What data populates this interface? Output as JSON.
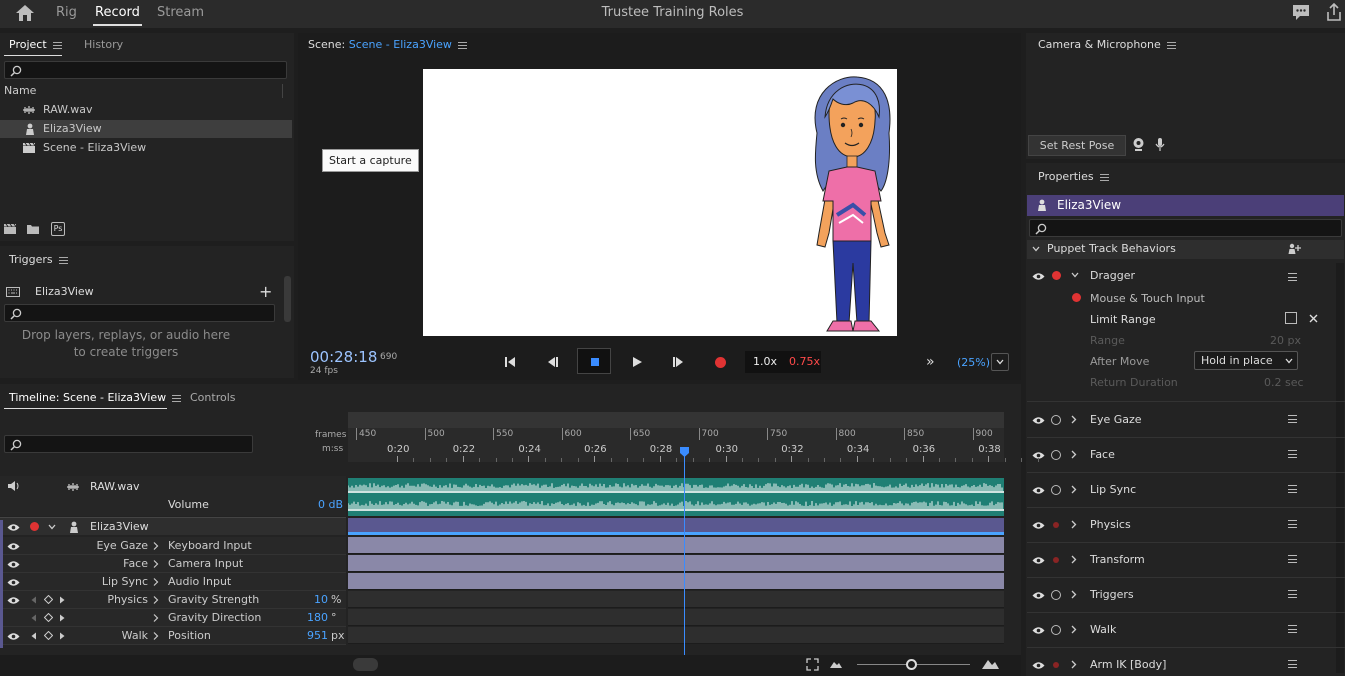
{
  "topbar": {
    "tabs": [
      "Rig",
      "Record",
      "Stream"
    ],
    "active_tab": "Record",
    "title": "Trustee Training Roles"
  },
  "project": {
    "tabs": [
      "Project",
      "History"
    ],
    "name_header": "Name",
    "items": [
      {
        "label": "RAW.wav",
        "icon": "audio-waveform-icon"
      },
      {
        "label": "Eliza3View",
        "icon": "puppet-icon",
        "selected": true
      },
      {
        "label": "Scene - Eliza3View",
        "icon": "scene-clapper-icon"
      }
    ],
    "ps_badge": "Ps"
  },
  "triggers": {
    "title": "Triggers",
    "puppet": "Eliza3View",
    "empty_text_1": "Drop layers, replays, or audio here",
    "empty_text_2": "to create triggers"
  },
  "scene": {
    "label": "Scene:",
    "name": "Scene - Eliza3View",
    "tooltip": "Start a capture",
    "timecode": "00:28:18",
    "frame": "690",
    "fps": "24 fps",
    "speed_a": "1.0x",
    "speed_b": "0.75x",
    "zoom": "(25%)"
  },
  "camera": {
    "title": "Camera & Microphone",
    "rest_pose": "Set Rest Pose"
  },
  "properties": {
    "title": "Properties",
    "puppet": "Eliza3View",
    "section": "Puppet Track Behaviors",
    "dragger": {
      "name": "Dragger",
      "input": "Mouse & Touch Input",
      "limit_range": "Limit Range",
      "range_label": "Range",
      "range_value": "20 px",
      "after_move_label": "After Move",
      "after_move_value": "Hold in place",
      "return_label": "Return Duration",
      "return_value": "0.2 sec"
    },
    "behaviors": [
      "Eye Gaze",
      "Face",
      "Lip Sync",
      "Physics",
      "Transform",
      "Triggers",
      "Walk",
      "Arm IK [Body]"
    ]
  },
  "timeline": {
    "tabs": [
      "Timeline: Scene - Eliza3View",
      "Controls"
    ],
    "frames_label": "frames",
    "mss_label": "m:ss",
    "frame_ticks": [
      "450",
      "500",
      "550",
      "600",
      "650",
      "700",
      "750",
      "800",
      "850",
      "900"
    ],
    "time_ticks": [
      "0:20",
      "0:22",
      "0:24",
      "0:26",
      "0:28",
      "0:30",
      "0:32",
      "0:34",
      "0:36",
      "0:38"
    ],
    "audio_track": "RAW.wav",
    "volume_label": "Volume",
    "volume_value": "0 dB",
    "puppet_track": "Eliza3View",
    "rows": [
      {
        "behavior": "Eye Gaze",
        "param": "Keyboard Input",
        "value": "",
        "unit": ""
      },
      {
        "behavior": "Face",
        "param": "Camera Input",
        "value": "",
        "unit": ""
      },
      {
        "behavior": "Lip Sync",
        "param": "Audio Input",
        "value": "",
        "unit": ""
      },
      {
        "behavior": "Physics",
        "param": "Gravity Strength",
        "value": "10",
        "unit": "%"
      },
      {
        "behavior": "",
        "param": "Gravity Direction",
        "value": "180",
        "unit": "°"
      },
      {
        "behavior": "Walk",
        "param": "Position",
        "value": "951",
        "unit": "px"
      }
    ]
  }
}
